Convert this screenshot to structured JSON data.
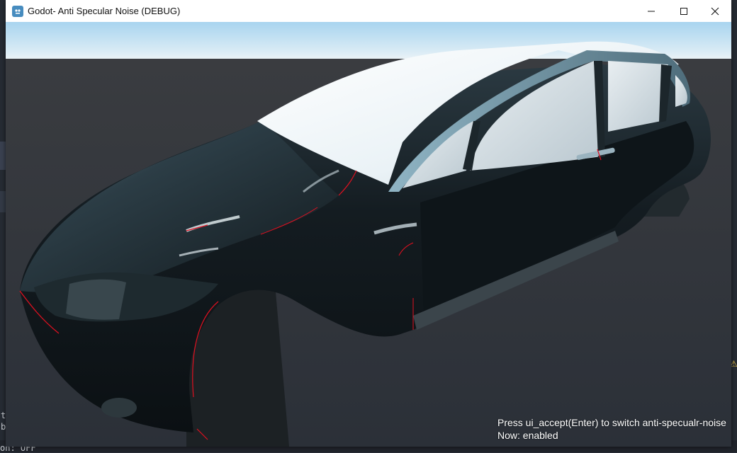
{
  "window": {
    "title": "Godot- Anti Specular Noise (DEBUG)",
    "app_icon": "godot-icon",
    "controls": [
      "minimize-icon",
      "maximize-icon",
      "close-icon"
    ]
  },
  "overlay": {
    "instruction": "Press ui_accept(Enter) to switch anti-specualr-noise",
    "status": "Now: enabled"
  },
  "background_editor": {
    "fragment_1": "t",
    "fragment_2": "b",
    "fragment_3": "on: OFF"
  },
  "colors": {
    "sky_top": "#a8d4ef",
    "horizon": "#e6f0f6",
    "ground": "#2f333b",
    "car_body": "#11181c",
    "highlight_edge": "#e01020"
  }
}
